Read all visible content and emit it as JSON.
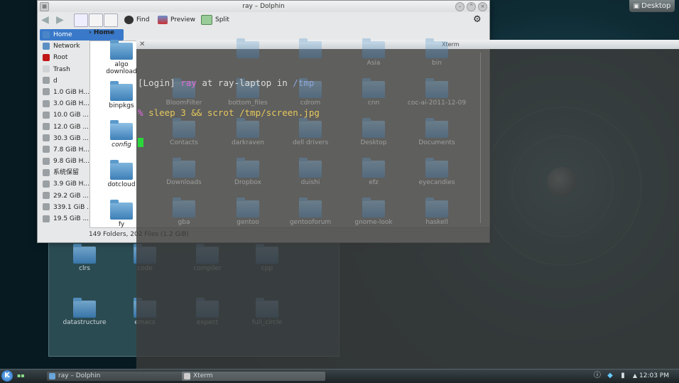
{
  "desktop": {
    "button_label": "Desktop",
    "background_files": [
      "clrs",
      "code",
      "compiler",
      "cpp",
      "datastructure",
      "emacs",
      "expect",
      "full_circle"
    ]
  },
  "dolphin": {
    "title": "ray – Dolphin",
    "toolbar": {
      "find": "Find",
      "preview": "Preview",
      "split": "Split"
    },
    "places": [
      {
        "label": "Home",
        "icon": "home-icon",
        "selected": true
      },
      {
        "label": "Network",
        "icon": "network-icon"
      },
      {
        "label": "Root",
        "icon": "root-folder-icon"
      },
      {
        "label": "Trash",
        "icon": "trash-icon"
      },
      {
        "label": "d",
        "icon": "drive-icon"
      },
      {
        "label": "1.0 GiB H...",
        "icon": "drive-icon"
      },
      {
        "label": "3.0 GiB H...",
        "icon": "drive-icon"
      },
      {
        "label": "10.0 GiB ...",
        "icon": "drive-icon"
      },
      {
        "label": "12.0 GiB ...",
        "icon": "drive-icon"
      },
      {
        "label": "30.3 GiB ...",
        "icon": "drive-icon"
      },
      {
        "label": "7.8 GiB H...",
        "icon": "drive-icon"
      },
      {
        "label": "9.8 GiB H...",
        "icon": "drive-icon"
      },
      {
        "label": "系统保留",
        "icon": "drive-icon"
      },
      {
        "label": "3.9 GiB H...",
        "icon": "drive-icon"
      },
      {
        "label": "29.2 GiB ...",
        "icon": "drive-icon"
      },
      {
        "label": "339.1 GiB ...",
        "icon": "drive-icon"
      },
      {
        "label": "19.5 GiB ...",
        "icon": "drive-icon"
      }
    ],
    "breadcrumb": "Home",
    "files_left": [
      "algo\ndownload",
      "binpkgs",
      "config",
      "dotcloud",
      "fy"
    ],
    "files_grid": [
      [
        "",
        "",
        "Asia",
        "bin"
      ],
      [
        "BloomFilter",
        "bottom_files",
        "cdrom",
        "cnn",
        "coc-ai-2011-12-09"
      ],
      [
        "Contacts",
        "darkraven",
        "dell drivers",
        "Desktop",
        "Documents"
      ],
      [
        "Downloads",
        "Dropbox",
        "duishi",
        "efz",
        "eyecandies"
      ],
      [
        "gba",
        "gentoo",
        "gentooforum",
        "gnome-look",
        "haskell"
      ]
    ],
    "status": "149 Folders, 202 Files (1.2 GiB)"
  },
  "xterm": {
    "title": "Xterm",
    "line1": {
      "bracket_open": "[",
      "login": "Login",
      "bracket_close": "]",
      "user": "ray",
      "at": " at ",
      "host": "ray-laptop",
      "in": " in ",
      "dir": "/tmp"
    },
    "line2": {
      "prompt": "% ",
      "command": "sleep 3 && scrot /tmp/screen.jpg"
    }
  },
  "taskbar": {
    "tasks": [
      "ray – Dolphin",
      "Xterm"
    ],
    "clock": "12:03 PM"
  }
}
